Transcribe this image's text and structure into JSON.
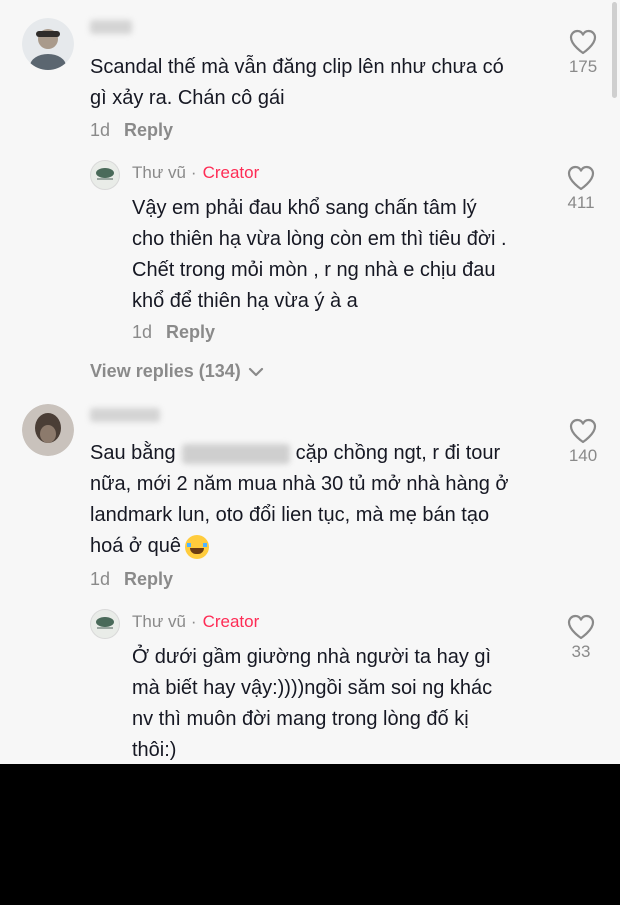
{
  "comments": [
    {
      "author_name": "",
      "lines": [
        "Scandal thế mà vẫn đăng clip lên như chưa có",
        "gì xảy ra. Chán cô gái"
      ],
      "age": "1d",
      "reply_label": "Reply",
      "likes": "175"
    },
    {
      "author_name": "Thư vũ",
      "author_badge": "Creator",
      "lines": [
        "Vậy em phải đau khổ sang chấn tâm lý",
        "cho thiên hạ vừa lòng còn em thì tiêu đời .",
        "Chết trong mỏi mòn , r ng nhà e chịu đau",
        "khổ để thiên hạ vừa ý à a"
      ],
      "age": "1d",
      "reply_label": "Reply",
      "likes": "411"
    },
    {
      "author_name": "",
      "line1_pre": "Sau bằng",
      "line1_post": "cặp chồng ngt, r đi tour",
      "lines_rest": [
        "nữa, mới 2 năm mua nhà 30 tủ mở nhà hàng ở",
        "landmark lun, oto đổi lien tục, mà mẹ bán tạo"
      ],
      "line_last": "hoá ở quê",
      "emoji_name": "laughing-tears-emoji",
      "age": "1d",
      "reply_label": "Reply",
      "likes": "140"
    },
    {
      "author_name": "Thư vũ",
      "author_badge": "Creator",
      "lines": [
        "Ở dưới gầm giường nhà người ta hay gì",
        "mà biết hay vậy:))))ngồi săm soi ng khác",
        "nv thì muôn đời mang trong lòng đố kị",
        "thôi:)"
      ],
      "likes": "33"
    }
  ],
  "view_replies_label": "View replies (134)",
  "icons": {
    "like": "heart-outline-icon",
    "expand": "chevron-down-icon"
  },
  "colors": {
    "background": "#f7f7f7",
    "creator_badge": "#fe2c55",
    "text": "#161823",
    "muted": "#8a8a8a"
  }
}
